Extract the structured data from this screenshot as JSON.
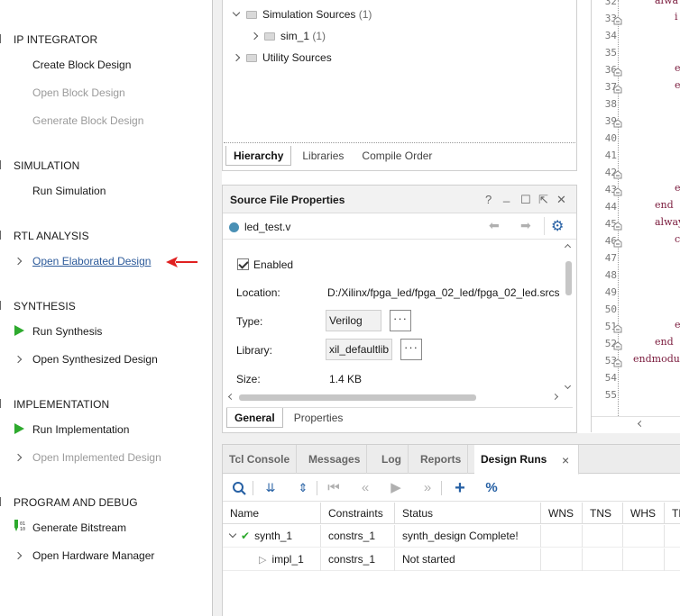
{
  "flow": {
    "sections": [
      {
        "title": "IP INTEGRATOR",
        "items": [
          "Create Block Design",
          "Open Block Design",
          "Generate Block Design"
        ]
      },
      {
        "title": "SIMULATION",
        "items": [
          "Run Simulation"
        ]
      },
      {
        "title": "RTL ANALYSIS",
        "items": [
          "Open Elaborated Design"
        ]
      },
      {
        "title": "SYNTHESIS",
        "items": [
          "Run Synthesis",
          "Open Synthesized Design"
        ]
      },
      {
        "title": "IMPLEMENTATION",
        "items": [
          "Run Implementation",
          "Open Implemented Design"
        ]
      },
      {
        "title": "PROGRAM AND DEBUG",
        "items": [
          "Generate Bitstream",
          "Open Hardware Manager"
        ]
      }
    ],
    "disabled_color": "#9a9a9a",
    "link_color": "#2c5a9a",
    "annotation_arrow_color": "#e02020"
  },
  "sources": {
    "tree": [
      {
        "label": "Simulation Sources",
        "count": "(1)"
      },
      {
        "label": "sim_1",
        "count": "(1)"
      },
      {
        "label": "Utility Sources",
        "count": ""
      }
    ],
    "tabs": [
      "Hierarchy",
      "Libraries",
      "Compile Order"
    ]
  },
  "properties": {
    "title": "Source File Properties",
    "header_icons": [
      "?",
      "_",
      "☐",
      "⇱",
      "✕"
    ],
    "file_name": "led_test.v",
    "enabled_label": "Enabled",
    "rows": {
      "location_label": "Location:",
      "location_value": "D:/Xilinx/fpga_led/fpga_02_led/fpga_02_led.srcs",
      "type_label": "Type:",
      "type_value": "Verilog",
      "library_label": "Library:",
      "library_value": "xil_defaultlib",
      "size_label": "Size:",
      "size_value": "1.4 KB"
    },
    "dots": "···",
    "tabs": [
      "General",
      "Properties"
    ],
    "accent_color": "#2660a4"
  },
  "editor": {
    "line_numbers": [
      "32",
      "33",
      "34",
      "35",
      "36",
      "37",
      "38",
      "39",
      "40",
      "41",
      "42",
      "43",
      "44",
      "45",
      "46",
      "47",
      "48",
      "49",
      "50",
      "51",
      "52",
      "53",
      "54",
      "55"
    ],
    "code": {
      "l32": "alwa",
      "l33": "i",
      "l36": "e",
      "l37": "e",
      "l43": "e",
      "l44": "end",
      "l45": "alway",
      "l46": "c",
      "l51": "e",
      "l52": "end",
      "l53": "endmodule"
    },
    "code_color": "#7a1a3c"
  },
  "runs": {
    "tabs": [
      "Tcl Console",
      "Messages",
      "Log",
      "Reports",
      "Design Runs"
    ],
    "close": "×",
    "columns": [
      "Name",
      "Constraints",
      "Status",
      "WNS",
      "TNS",
      "WHS",
      "TH"
    ],
    "rows": [
      {
        "name": "synth_1",
        "constraints": "constrs_1",
        "status": "synth_design Complete!"
      },
      {
        "name": "impl_1",
        "constraints": "constrs_1",
        "status": "Not started"
      }
    ],
    "success_color": "#2eaa2e"
  }
}
